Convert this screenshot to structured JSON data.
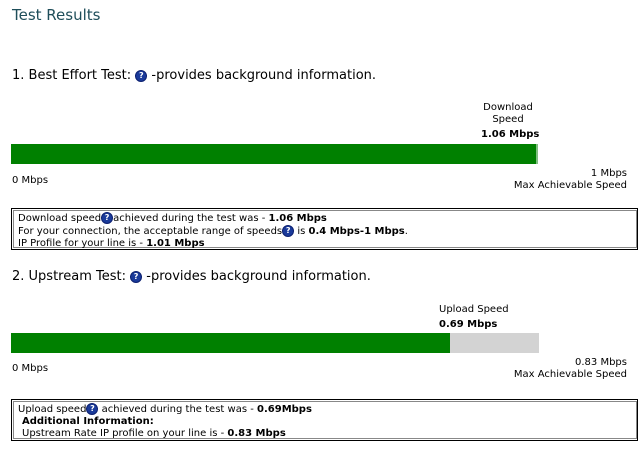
{
  "title": "Test Results",
  "colors": {
    "bar_fill": "#008000",
    "bar_track": "#d3d3d3",
    "title": "#1f4e5a",
    "info_icon": "#1a3a9a"
  },
  "icons": {
    "info": "info-icon"
  },
  "best_effort": {
    "heading_prefix": "1. Best Effort Test:",
    "heading_suffix": " -provides background information.",
    "speed_label_line1": "Download",
    "speed_label_line2": "Speed",
    "speed_value": "1.06 Mbps",
    "bar_fraction": 1.0,
    "min_label": "0 Mbps",
    "max_value": "1 Mbps",
    "max_label": "Max Achievable Speed",
    "info": {
      "line1_prefix": "Download speed",
      "line1_middle": "achieved during the test was - ",
      "line1_value": "1.06 Mbps",
      "line2_prefix": "For your connection, the acceptable range of speeds",
      "line2_middle": " is ",
      "line2_value": "0.4 Mbps-1 Mbps",
      "line2_suffix": ".",
      "line3_prefix": "IP Profile for your line is - ",
      "line3_value": "1.01 Mbps"
    }
  },
  "upstream": {
    "heading_prefix": "2. Upstream Test:",
    "heading_suffix": " -provides background information.",
    "speed_label": "Upload Speed",
    "speed_value": "0.69 Mbps",
    "bar_fraction": 0.8313,
    "min_label": "0 Mbps",
    "max_value": "0.83 Mbps",
    "max_label": "Max Achievable Speed",
    "info": {
      "line1_prefix": "Upload speed",
      "line1_middle": " achieved during the test was - ",
      "line1_value": "0.69Mbps",
      "line2": "Additional Information:",
      "line3_prefix": "Upstream Rate IP profile on your line is - ",
      "line3_value": "0.83 Mbps"
    }
  }
}
